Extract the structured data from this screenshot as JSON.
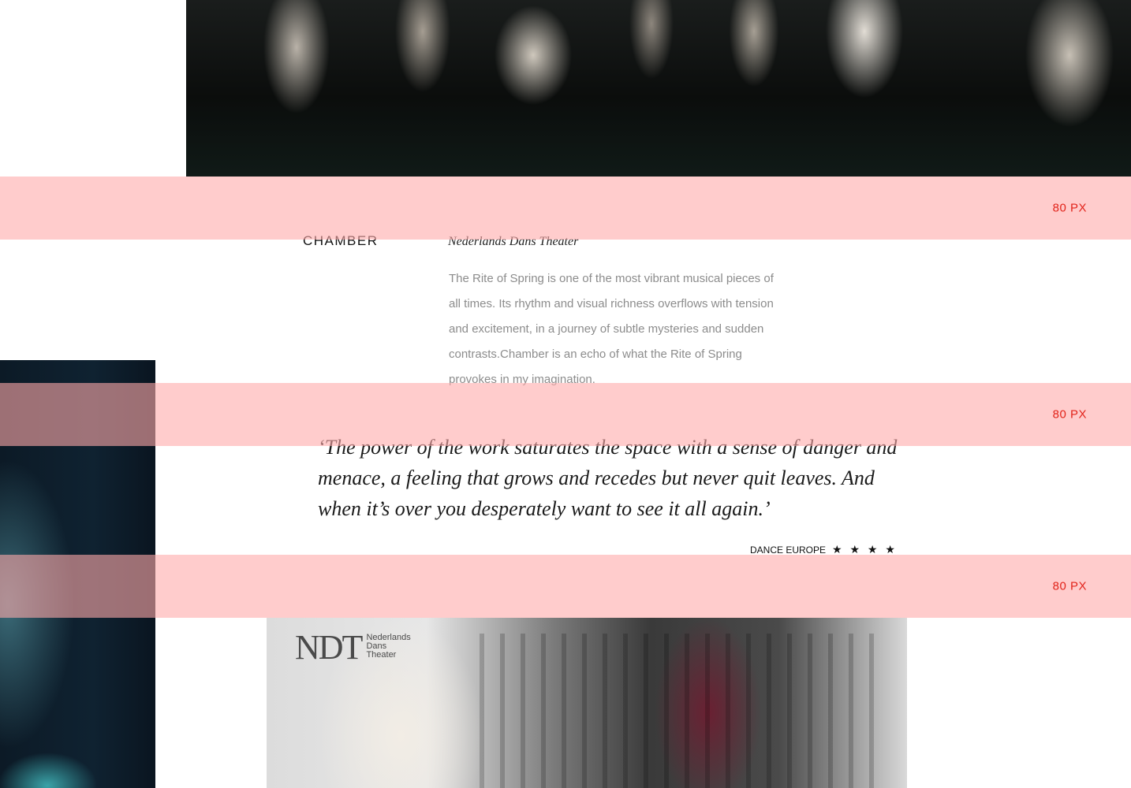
{
  "colors": {
    "guide_band": "#ffaaaa",
    "guide_label": "#e2231a",
    "body_text": "#8c8c8c"
  },
  "guides": [
    {
      "label": "80 PX"
    },
    {
      "label": "80 PX"
    },
    {
      "label": "80 PX"
    }
  ],
  "piece": {
    "title": "CHAMBER",
    "company": "Nederlands Dans Theater",
    "description": "The Rite of Spring is one of the most vibrant musical pieces of all times. Its rhythm and visual richness overflows with tension and excitement, in a journey of subtle mysteries and sudden contrasts.Chamber is an echo of what the Rite of Spring provokes in my imagination."
  },
  "quote": {
    "text": "‘The power of the work saturates the space with a sense of danger and menace, a feeling that grows and recedes but never quit leaves. And when it’s over you desperately want to see it all again.’",
    "source": "DANCE EUROPE",
    "stars": "★ ★ ★ ★"
  },
  "video": {
    "logo_mark": "NDT",
    "logo_words": [
      "Nederlands",
      "Dans",
      "Theater"
    ]
  }
}
